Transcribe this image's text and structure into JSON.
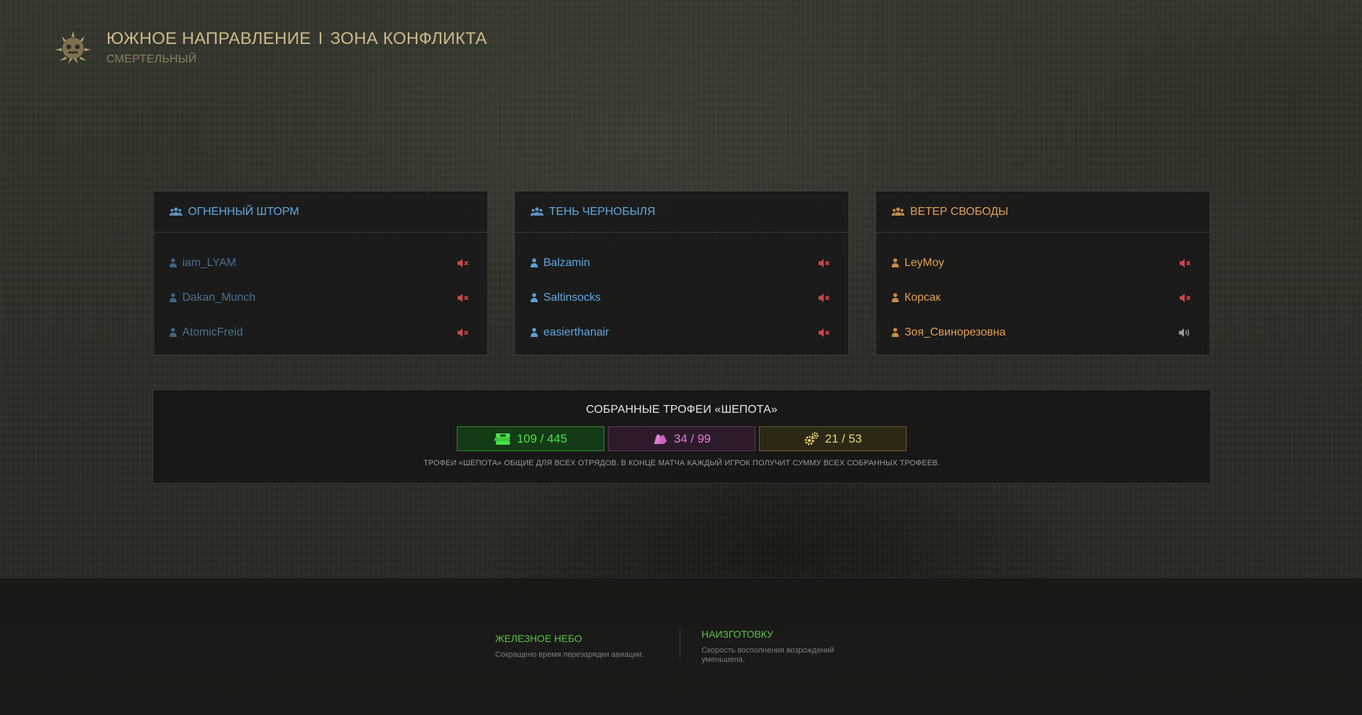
{
  "header": {
    "title_left": "ЮЖНОЕ НАПРАВЛЕНИЕ",
    "separator": "I",
    "title_right": "ЗОНА КОНФЛИКТА",
    "subtitle": "СМЕРТЕЛЬНЫЙ",
    "emblem_icon": "spiked-skull-emblem-icon"
  },
  "squads": [
    {
      "name": "ОГНЕННЫЙ ШТОРМ",
      "color": "#5fa9e0",
      "players": [
        {
          "name": "iam_LYAM",
          "muted": true
        },
        {
          "name": "Dakan_Munch",
          "muted": true
        },
        {
          "name": "AtomicFreid",
          "muted": true
        }
      ]
    },
    {
      "name": "ТЕНЬ ЧЕРНОБЫЛЯ",
      "color": "#5fa9e0",
      "players": [
        {
          "name": "Balzamin",
          "muted": true
        },
        {
          "name": "Saltinsocks",
          "muted": true
        },
        {
          "name": "easierthanair",
          "muted": true
        }
      ]
    },
    {
      "name": "ВЕТЕР СВОБОДЫ",
      "color": "#e3a055",
      "players": [
        {
          "name": "LeyMoy",
          "muted": true
        },
        {
          "name": "Корсак",
          "muted": true
        },
        {
          "name": "Зоя_Свинорезовна",
          "muted": false
        }
      ]
    }
  ],
  "trophies": {
    "title": "СОБРАННЫЕ ТРОФЕИ «ШЕПОТА»",
    "counters": [
      {
        "icon": "cash-stack-icon",
        "value": "109 / 445",
        "color": "#47e347"
      },
      {
        "icon": "gloves-icon",
        "value": "34 / 99",
        "color": "#df7bd6"
      },
      {
        "icon": "gears-icon",
        "value": "21 / 53",
        "color": "#e6d477"
      }
    ],
    "note": "ТРОФЕИ «ШЕПОТА» ОБЩИЕ ДЛЯ ВСЕХ ОТРЯДОВ. В КОНЦЕ МАТЧА КАЖДЫЙ ИГРОК ПОЛУЧИТ СУММУ ВСЕХ СОБРАННЫХ ТРОФЕЕВ."
  },
  "perks": [
    {
      "title": "ЖЕЛЕЗНОЕ НЕБО",
      "desc": "Сокращено время перезарядки авиации."
    },
    {
      "title": "НАИЗГОТОВКУ",
      "desc": "Скорость восполнения возрождений уменьшена."
    }
  ]
}
